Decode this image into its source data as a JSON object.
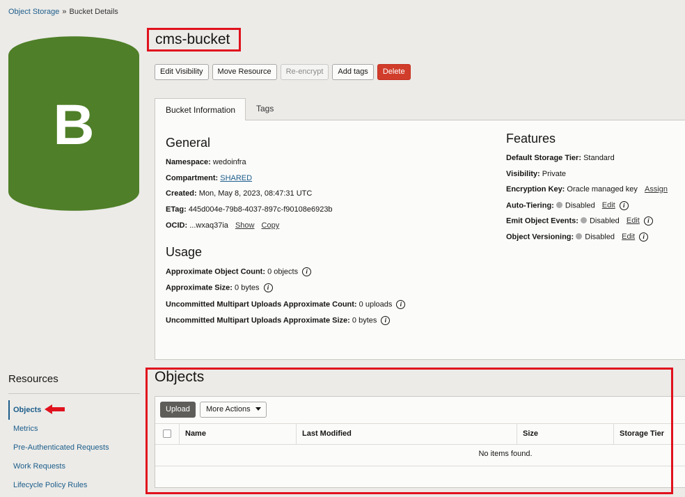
{
  "breadcrumb": {
    "parent": "Object Storage",
    "separator": "»",
    "current": "Bucket Details"
  },
  "bucket_icon": {
    "letter": "B",
    "color": "#4f7f28"
  },
  "page_title": "cms-bucket",
  "actions": {
    "edit_visibility": "Edit Visibility",
    "move_resource": "Move Resource",
    "re_encrypt": "Re-encrypt",
    "add_tags": "Add tags",
    "delete": "Delete"
  },
  "tabs": {
    "bucket_info": "Bucket Information",
    "tags": "Tags"
  },
  "general": {
    "title": "General",
    "namespace_label": "Namespace:",
    "namespace": "wedoinfra",
    "compartment_label": "Compartment:",
    "compartment": "SHARED",
    "created_label": "Created:",
    "created": "Mon, May 8, 2023, 08:47:31 UTC",
    "etag_label": "ETag:",
    "etag": "445d004e-79b8-4037-897c-f90108e6923b",
    "ocid_label": "OCID:",
    "ocid": "...wxaq37ia",
    "show": "Show",
    "copy": "Copy"
  },
  "usage": {
    "title": "Usage",
    "object_count_label": "Approximate Object Count:",
    "object_count": "0 objects",
    "size_label": "Approximate Size:",
    "size": "0 bytes",
    "multipart_count_label": "Uncommitted Multipart Uploads Approximate Count:",
    "multipart_count": "0 uploads",
    "multipart_size_label": "Uncommitted Multipart Uploads Approximate Size:",
    "multipart_size": "0 bytes"
  },
  "features": {
    "title": "Features",
    "storage_tier_label": "Default Storage Tier:",
    "storage_tier": "Standard",
    "visibility_label": "Visibility:",
    "visibility": "Private",
    "encryption_label": "Encryption Key:",
    "encryption": "Oracle managed key",
    "assign": "Assign",
    "auto_tiering_label": "Auto-Tiering:",
    "auto_tiering": "Disabled",
    "emit_events_label": "Emit Object Events:",
    "emit_events": "Disabled",
    "versioning_label": "Object Versioning:",
    "versioning": "Disabled",
    "edit": "Edit"
  },
  "resources": {
    "title": "Resources",
    "items": [
      "Objects",
      "Metrics",
      "Pre-Authenticated Requests",
      "Work Requests",
      "Lifecycle Policy Rules"
    ]
  },
  "objects": {
    "title": "Objects",
    "upload": "Upload",
    "more_actions": "More Actions",
    "columns": [
      "Name",
      "Last Modified",
      "Size",
      "Storage Tier"
    ],
    "empty": "No items found."
  },
  "colors": {
    "accent_red": "#e0121d",
    "link": "#1c5d8a",
    "danger": "#d13d2b"
  }
}
